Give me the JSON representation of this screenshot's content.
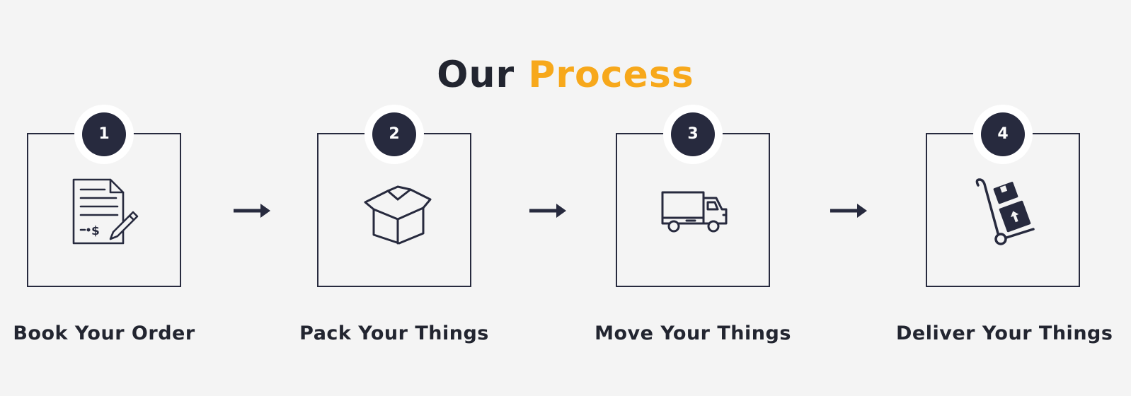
{
  "header": {
    "title_part1": "Our",
    "title_part2": "Process"
  },
  "colors": {
    "accent": "#f7a81b",
    "dark": "#272a3e",
    "background": "#f4f4f4"
  },
  "steps": [
    {
      "number": "1",
      "label": "Book Your Order",
      "icon": "document-pencil-icon"
    },
    {
      "number": "2",
      "label": "Pack Your Things",
      "icon": "open-box-icon"
    },
    {
      "number": "3",
      "label": "Move Your Things",
      "icon": "truck-icon"
    },
    {
      "number": "4",
      "label": "Deliver Your Things",
      "icon": "hand-truck-icon"
    }
  ]
}
